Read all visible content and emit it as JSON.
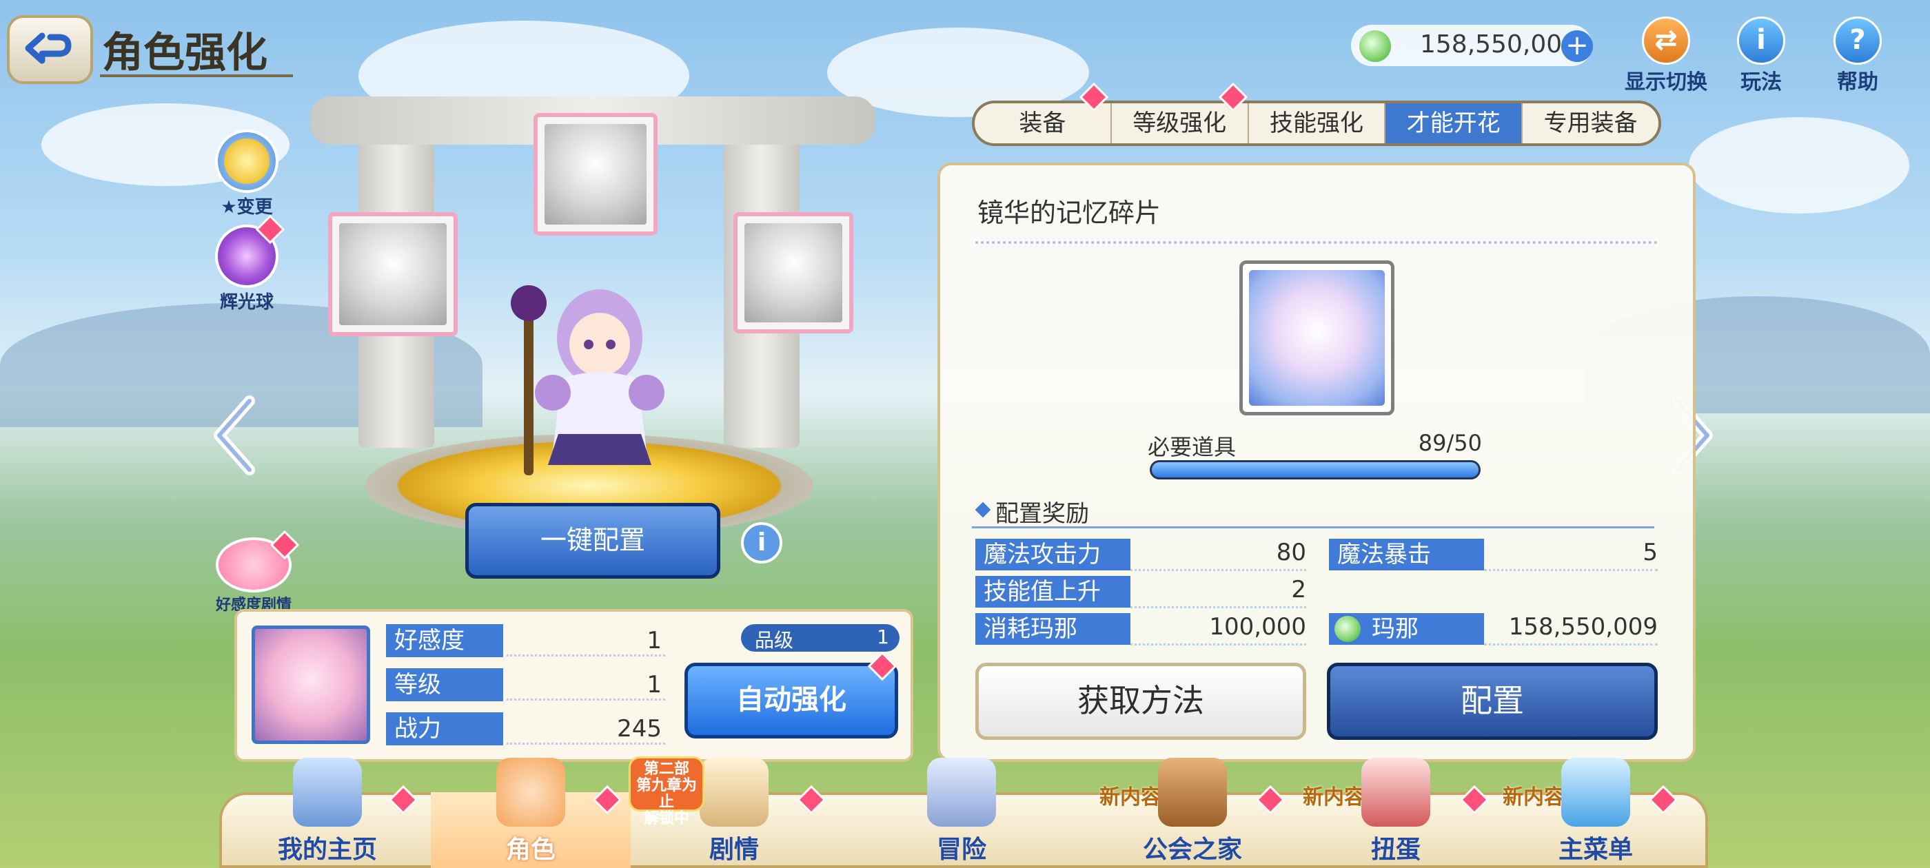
{
  "header": {
    "title": "角色强化",
    "back_label": "返回"
  },
  "currency": {
    "value": "158,550,009",
    "plus": "+"
  },
  "top_buttons": {
    "display_switch": "显示切换",
    "how_to_play": "玩法",
    "help": "帮助",
    "info_glyph": "i",
    "help_glyph": "?"
  },
  "side_buttons": {
    "star_change": "★变更",
    "glow_orb": "辉光球",
    "affection_story": "好感度剧情"
  },
  "actions": {
    "one_click_equip": "一键配置",
    "info_glyph": "i",
    "auto_enhance": "自动强化"
  },
  "character": {
    "stats": [
      {
        "label": "好感度",
        "value": "1"
      },
      {
        "label": "等级",
        "value": "1"
      },
      {
        "label": "战力",
        "value": "245"
      }
    ],
    "grade_label": "品级",
    "grade_value": "1"
  },
  "tabs": [
    {
      "label": "装备",
      "active": false,
      "badge": true
    },
    {
      "label": "等级强化",
      "active": false,
      "badge": true
    },
    {
      "label": "技能强化",
      "active": false,
      "badge": false
    },
    {
      "label": "才能开花",
      "active": true,
      "badge": false
    },
    {
      "label": "专用装备",
      "active": false,
      "badge": false
    }
  ],
  "panel": {
    "item_title": "镜华的记忆碎片",
    "required_label": "必要道具",
    "required_value": "89/50",
    "progress_fraction": 1.0,
    "reward_header": "配置奖励",
    "rewards": {
      "magic_attack_label": "魔法攻击力",
      "magic_attack_value": "80",
      "magic_crit_label": "魔法暴击",
      "magic_crit_value": "5",
      "skill_up_label": "技能值上升",
      "skill_up_value": "2",
      "cost_mana_label": "消耗玛那",
      "cost_mana_value": "100,000",
      "mana_label": "玛那",
      "mana_value": "158,550,009"
    },
    "get_method_label": "获取方法",
    "config_label": "配置"
  },
  "bottom_nav": [
    {
      "label": "我的主页",
      "new": "",
      "active": false
    },
    {
      "label": "角色",
      "new": "",
      "active": true
    },
    {
      "label": "剧情",
      "new": "",
      "active": false
    },
    {
      "label": "冒险",
      "new": "",
      "active": false
    },
    {
      "label": "公会之家",
      "new": "新内容",
      "active": false
    },
    {
      "label": "扭蛋",
      "new": "新内容",
      "active": false
    },
    {
      "label": "主菜单",
      "new": "新内容",
      "active": false
    }
  ],
  "story_tag": {
    "line1": "第二部",
    "line2": "第九章为止",
    "line3": "解锁中"
  },
  "colors": {
    "accent_blue": "#3f7bd7",
    "badge_pink": "#ff4f7a",
    "panel_border": "#d6c18a"
  }
}
